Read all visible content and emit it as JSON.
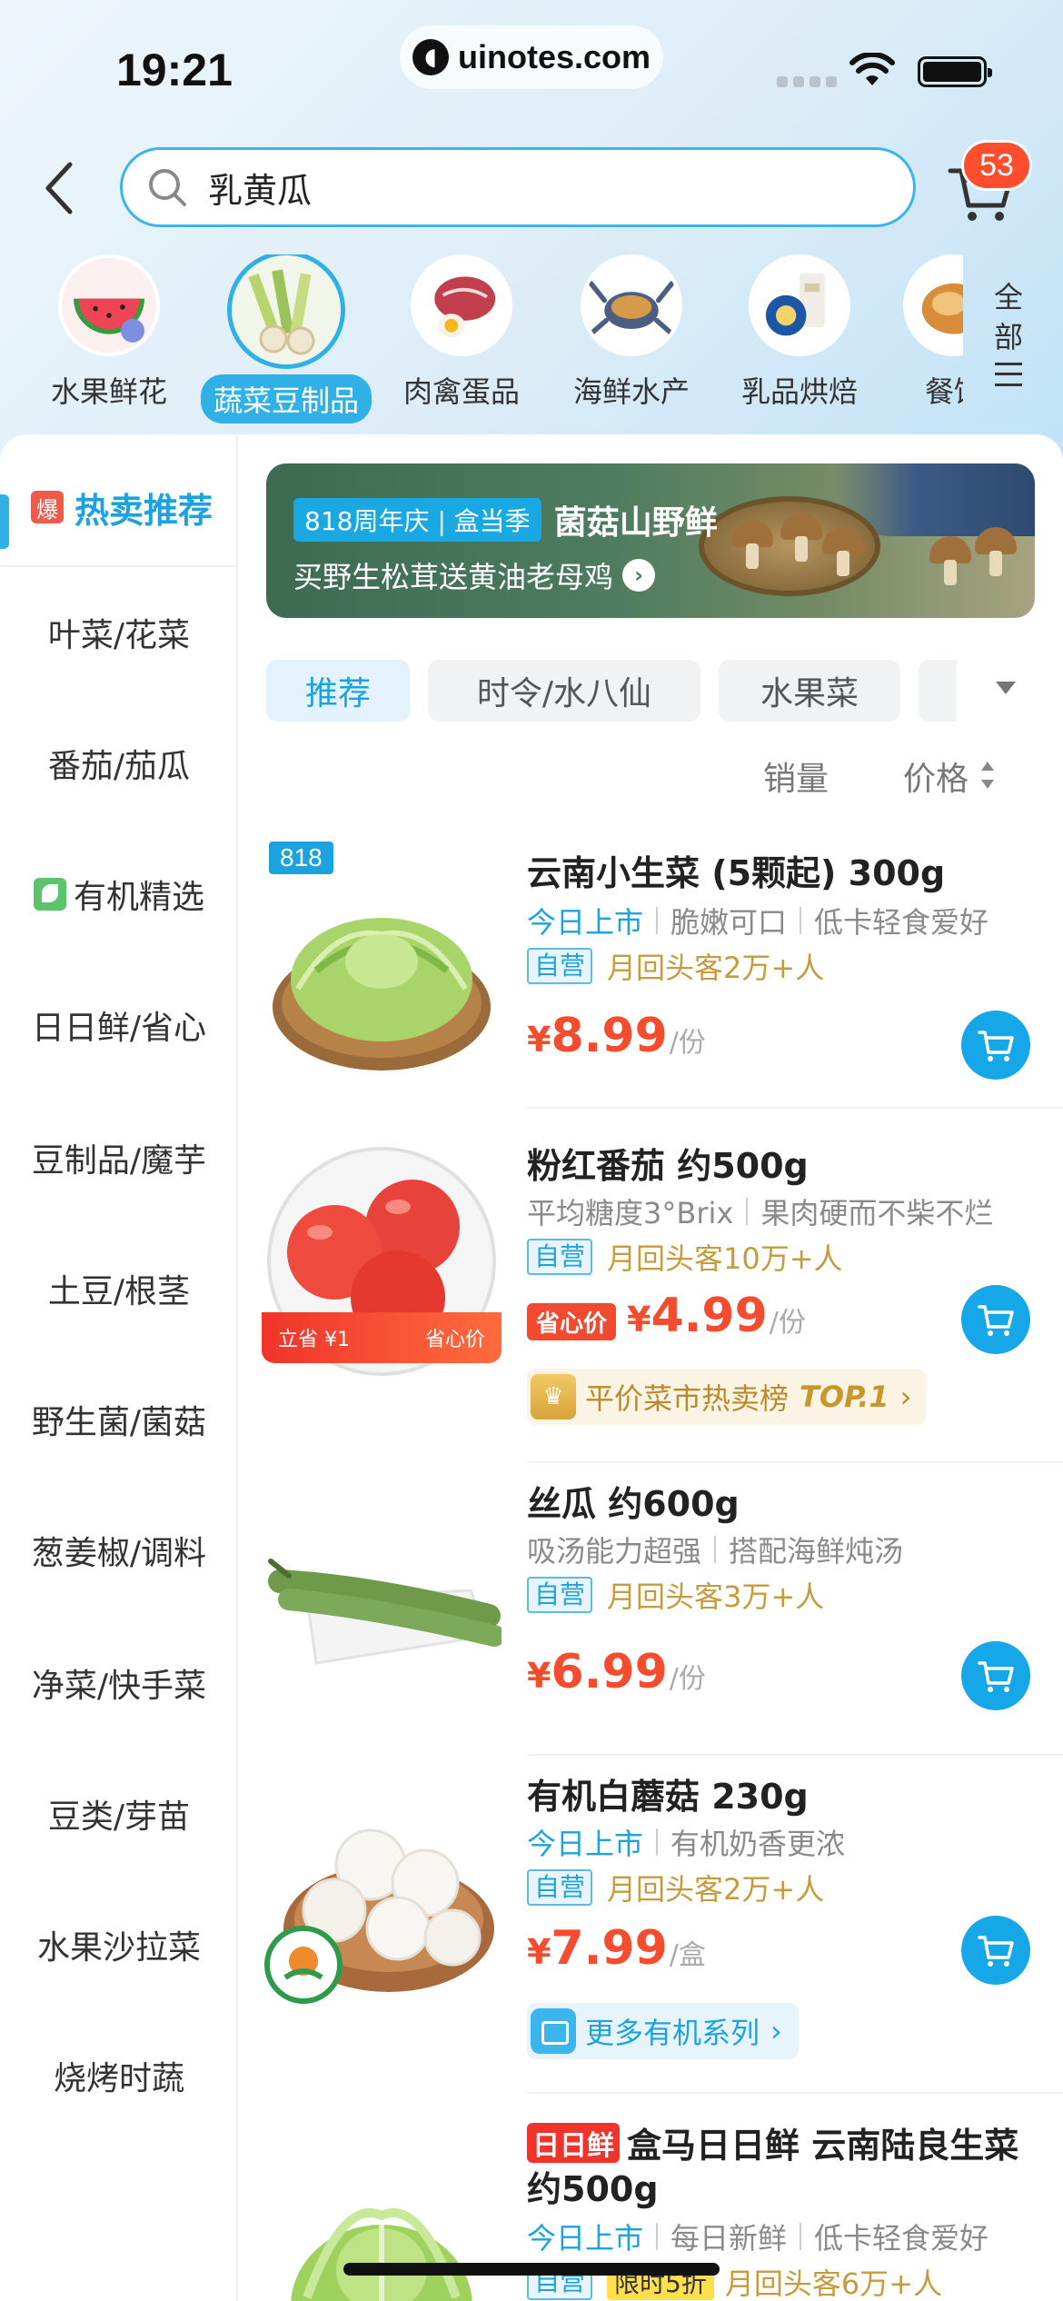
{
  "status": {
    "time": "19:21",
    "url": "uinotes.com"
  },
  "search": {
    "value": "乳黄瓜",
    "cart_count": "53"
  },
  "categories": [
    {
      "label": "水果鲜花",
      "icon": "watermelon-icon"
    },
    {
      "label": "蔬菜豆制品",
      "icon": "vegetables-icon",
      "active": true
    },
    {
      "label": "肉禽蛋品",
      "icon": "meat-icon"
    },
    {
      "label": "海鲜水产",
      "icon": "crab-icon"
    },
    {
      "label": "乳品烘焙",
      "icon": "dairy-icon"
    },
    {
      "label": "餐饮",
      "icon": "bread-icon"
    }
  ],
  "all_categories": [
    "全",
    "部"
  ],
  "sidebar": {
    "hot": {
      "badge": "爆",
      "label": "热卖推荐"
    },
    "items": [
      "叶菜/花菜",
      "番茄/茄瓜",
      "有机精选",
      "日日鲜/省心",
      "豆制品/魔芋",
      "土豆/根茎",
      "野生菌/菌菇",
      "葱姜椒/调料",
      "净菜/快手菜",
      "豆类/芽苗",
      "水果沙拉菜",
      "烧烤时蔬"
    ]
  },
  "banner": {
    "tag": "818周年庆 | 盒当季",
    "title": "菌菇山野鲜",
    "subtitle": "买野生松茸送黄油老母鸡"
  },
  "tabs": [
    "推荐",
    "时令/水八仙",
    "水果菜"
  ],
  "sort": {
    "sales": "销量",
    "price": "价格"
  },
  "products": [
    {
      "badge": "818",
      "name": "云南小生菜 (5颗起) 300g",
      "features": [
        "今日上市",
        "脆嫩可口",
        "低卡轻食爱好"
      ],
      "ziying": "自营",
      "repeat": "月回头客2万+人",
      "yen": "¥",
      "price": "8.99",
      "unit": "/份"
    },
    {
      "name": "粉红番茄 约500g",
      "features": [
        "平均糖度3°Brix",
        "果肉硬而不柴不烂"
      ],
      "ziying": "自营",
      "repeat": "月回头客10万+人",
      "shengxin": "省心价",
      "yen": "¥",
      "price": "4.99",
      "unit": "/份",
      "save_left": "立省 ¥1",
      "save_right": "省心价",
      "rank": {
        "text": "平价菜市热卖榜",
        "top": "TOP.1"
      }
    },
    {
      "name": "丝瓜 约600g",
      "features": [
        "吸汤能力超强",
        "搭配海鲜炖汤"
      ],
      "ziying": "自营",
      "repeat": "月回头客3万+人",
      "yen": "¥",
      "price": "6.99",
      "unit": "/份"
    },
    {
      "name": "有机白蘑菇 230g",
      "features": [
        "今日上市",
        "有机奶香更浓"
      ],
      "ziying": "自营",
      "repeat": "月回头客2万+人",
      "yen": "¥",
      "price": "7.99",
      "unit": "/盒",
      "more": "更多有机系列"
    },
    {
      "tag": "日日鲜",
      "name1": "盒马日日鲜 云南陆良生菜",
      "name2": "约500g",
      "features": [
        "今日上市",
        "每日新鲜",
        "低卡轻食爱好"
      ],
      "ziying": "自营",
      "xianshi": "限时5折",
      "repeat": "月回头客6万+人"
    }
  ]
}
